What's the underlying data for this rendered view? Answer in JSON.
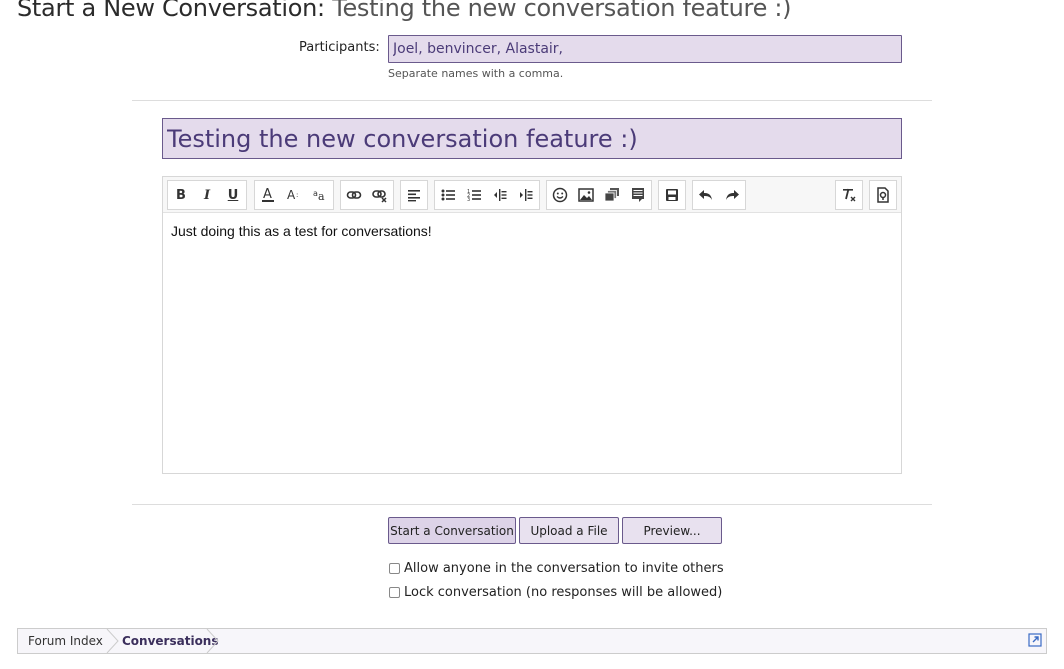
{
  "header": {
    "title_prefix": "Start a New Conversation:",
    "title_subject": "Testing the new conversation feature :)"
  },
  "participants": {
    "label": "Participants:",
    "value": "Joel, benvincer, Alastair,",
    "hint": "Separate names with a comma."
  },
  "conversation": {
    "title_value": "Testing the new conversation feature :)",
    "body": "Just doing this as a test for conversations!"
  },
  "toolbar": {
    "icons": [
      "bold-icon",
      "italic-icon",
      "underline-icon",
      "font-color-icon",
      "font-size-icon",
      "font-family-icon",
      "link-icon",
      "unlink-icon",
      "align-icon",
      "bullet-list-icon",
      "numbered-list-icon",
      "outdent-icon",
      "indent-icon",
      "smilie-icon",
      "image-icon",
      "media-icon",
      "quote-icon",
      "save-draft-icon",
      "undo-icon",
      "redo-icon",
      "remove-format-icon",
      "toggle-bbcode-icon"
    ],
    "bold": "B",
    "italic": "I",
    "underline": "U"
  },
  "buttons": {
    "start": "Start a Conversation",
    "upload": "Upload a File",
    "preview": "Preview..."
  },
  "options": {
    "invite_others": "Allow anyone in the conversation to invite others",
    "lock": "Lock conversation (no responses will be allowed)"
  },
  "breadcrumb": {
    "items": [
      "Forum Index",
      "Conversations"
    ]
  },
  "colors": {
    "accent": "#6a5a8c",
    "input_bg": "#e4dbec",
    "input_text": "#4b3b78"
  }
}
